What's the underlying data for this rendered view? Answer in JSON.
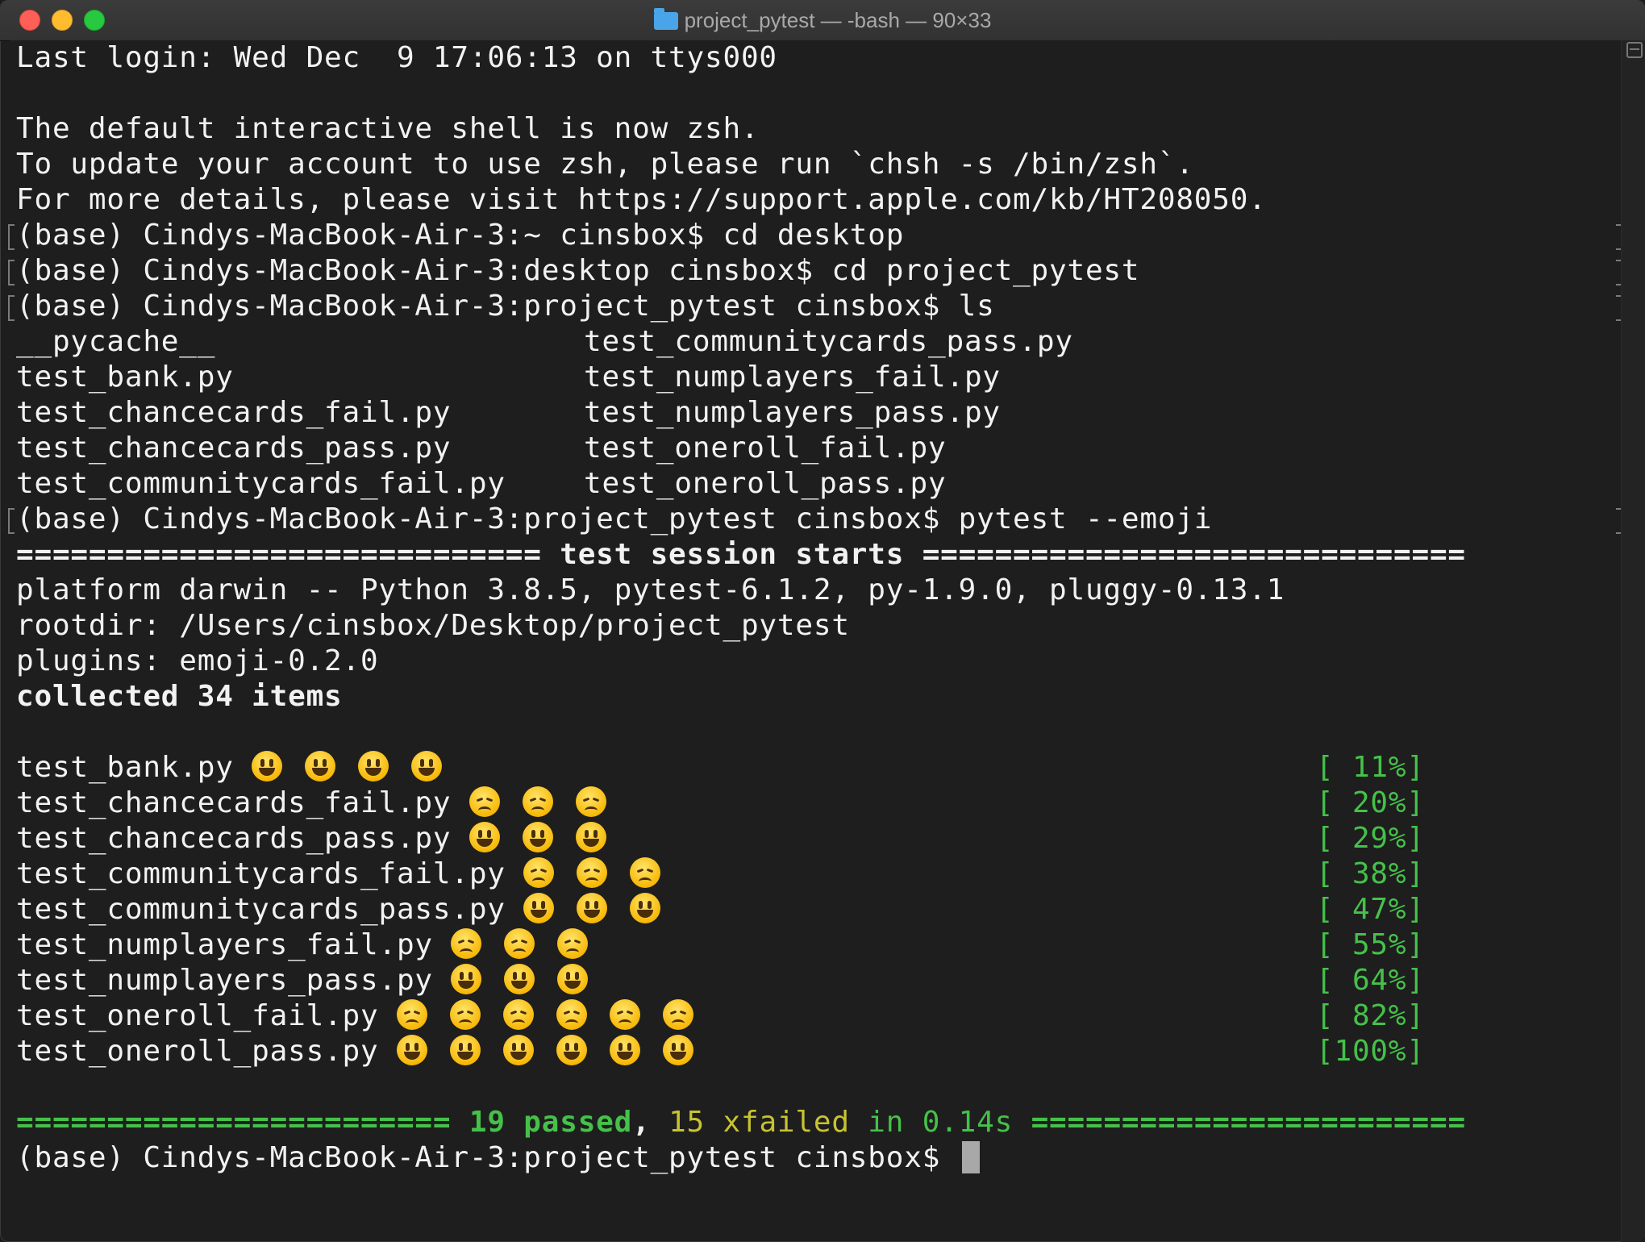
{
  "window": {
    "title": "project_pytest — -bash — 90×33"
  },
  "terminal": {
    "login": "Last login: Wed Dec  9 17:06:13 on ttys000",
    "shell_notice": [
      "The default interactive shell is now zsh.",
      "To update your account to use zsh, please run `chsh -s /bin/zsh`.",
      "For more details, please visit https://support.apple.com/kb/HT208050."
    ],
    "commands": [
      "(base) Cindys-MacBook-Air-3:~ cinsbox$ cd desktop",
      "(base) Cindys-MacBook-Air-3:desktop cinsbox$ cd project_pytest",
      "(base) Cindys-MacBook-Air-3:project_pytest cinsbox$ ls"
    ],
    "ls_left": [
      "__pycache__",
      "test_bank.py",
      "test_chancecards_fail.py",
      "test_chancecards_pass.py",
      "test_communitycards_fail.py"
    ],
    "ls_right": [
      "test_communitycards_pass.py",
      "test_numplayers_fail.py",
      "test_numplayers_pass.py",
      "test_oneroll_fail.py",
      "test_oneroll_pass.py"
    ],
    "pytest_command": "(base) Cindys-MacBook-Air-3:project_pytest cinsbox$ pytest --emoji",
    "session_header": "============================= test session starts ==============================",
    "platform": "platform darwin -- Python 3.8.5, pytest-6.1.2, py-1.9.0, pluggy-0.13.1",
    "rootdir": "rootdir: /Users/cinsbox/Desktop/project_pytest",
    "plugins": "plugins: emoji-0.2.0",
    "collected": "collected 34 items",
    "results": [
      {
        "file": "test_bank.py",
        "emojis": [
          "smile",
          "smile",
          "smile",
          "smile"
        ],
        "progress": "[ 11%]"
      },
      {
        "file": "test_chancecards_fail.py",
        "emojis": [
          "sad",
          "sad",
          "sad"
        ],
        "progress": "[ 20%]"
      },
      {
        "file": "test_chancecards_pass.py",
        "emojis": [
          "smile",
          "smile",
          "smile"
        ],
        "progress": "[ 29%]"
      },
      {
        "file": "test_communitycards_fail.py",
        "emojis": [
          "sad",
          "sad",
          "sad"
        ],
        "progress": "[ 38%]"
      },
      {
        "file": "test_communitycards_pass.py",
        "emojis": [
          "smile",
          "smile",
          "smile"
        ],
        "progress": "[ 47%]"
      },
      {
        "file": "test_numplayers_fail.py",
        "emojis": [
          "sad",
          "sad",
          "sad"
        ],
        "progress": "[ 55%]"
      },
      {
        "file": "test_numplayers_pass.py",
        "emojis": [
          "smile",
          "smile",
          "smile"
        ],
        "progress": "[ 64%]"
      },
      {
        "file": "test_oneroll_fail.py",
        "emojis": [
          "sad",
          "sad",
          "sad",
          "sad",
          "sad",
          "sad"
        ],
        "progress": "[ 82%]"
      },
      {
        "file": "test_oneroll_pass.py",
        "emojis": [
          "smile",
          "smile",
          "smile",
          "smile",
          "smile",
          "smile"
        ],
        "progress": "[100%]"
      }
    ],
    "summary": {
      "left_rule": "======================== ",
      "passed": "19 passed",
      "comma": ", ",
      "xfailed": "15 xfailed",
      "duration": " in 0.14s",
      "right_rule": " ========================"
    },
    "final_prompt": "(base) Cindys-MacBook-Air-3:project_pytest cinsbox$ "
  },
  "colors": {
    "pass_green": "#45c14a",
    "xfail_yellow": "#c7c330",
    "background": "#1e1e1e",
    "text": "#f2f2f2"
  }
}
